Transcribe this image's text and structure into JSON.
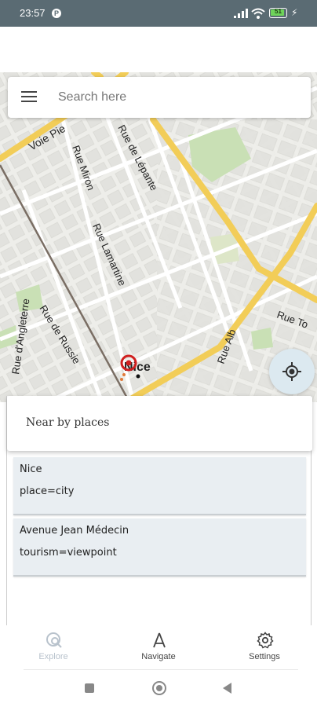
{
  "status_bar": {
    "time": "23:57",
    "notification_icon": "p-icon",
    "signal_icon": "signal-icon",
    "wifi_icon": "wifi-icon",
    "battery_level": "51",
    "charging_icon": "bolt-icon"
  },
  "search": {
    "menu_icon": "menu-icon",
    "placeholder": "Search here"
  },
  "map": {
    "street_labels": [
      "Voie Pie",
      "Rue Miron",
      "Rue de Lépante",
      "Rue Lamartine",
      "Rue d'Angleterre",
      "Rue de Russie",
      "Rue To",
      "Rue Alb",
      "Nice"
    ],
    "locate_icon": "my-location-icon",
    "marker_icon": "place-marker-icon"
  },
  "nearby": {
    "title": "Near by places",
    "places": [
      {
        "name": "Nice",
        "tag": "place=city"
      },
      {
        "name": "Avenue Jean Médecin",
        "tag": "tourism=viewpoint"
      }
    ]
  },
  "bottom_nav": {
    "items": [
      {
        "label": "Explore",
        "icon": "explore-icon",
        "color": "#b8c2cc"
      },
      {
        "label": "Navigate",
        "icon": "navigate-icon",
        "color": "#444444"
      },
      {
        "label": "Settings",
        "icon": "settings-icon",
        "color": "#444444"
      }
    ]
  },
  "colors": {
    "status_bar": "#5a6b73",
    "major_road": "#f2cd58",
    "map_background": "#eeeeea",
    "park": "#c9e0b5",
    "card_background": "#e9eef2",
    "locate_button": "#dce9f0"
  }
}
